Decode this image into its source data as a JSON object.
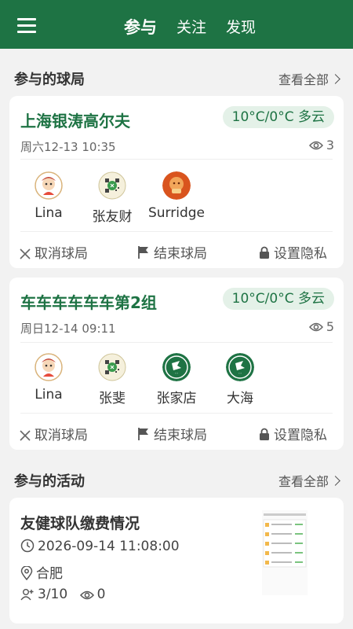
{
  "nav": {
    "tabs": [
      "参与",
      "关注",
      "发现"
    ]
  },
  "games_section": {
    "title": "参与的球局",
    "see_all": "查看全部"
  },
  "games": [
    {
      "title": "上海银涛高尔夫",
      "weather": "10°C/0°C 多云",
      "date": "周六12-13 10:35",
      "views": "3",
      "players": [
        {
          "name": "Lina",
          "avatar": "cartoon"
        },
        {
          "name": "张友财",
          "avatar": "qr"
        },
        {
          "name": "Surridge",
          "avatar": "orange"
        }
      ]
    },
    {
      "title": "车车车车车车第2组",
      "weather": "10°C/0°C 多云",
      "date": "周日12-14 09:11",
      "views": "5",
      "players": [
        {
          "name": "Lina",
          "avatar": "cartoon"
        },
        {
          "name": "张斐",
          "avatar": "qr"
        },
        {
          "name": "张家店",
          "avatar": "green"
        },
        {
          "name": "大海",
          "avatar": "green"
        }
      ]
    }
  ],
  "actions": {
    "cancel": "取消球局",
    "end": "结束球局",
    "privacy": "设置隐私"
  },
  "activities_section": {
    "title": "参与的活动",
    "see_all": "查看全部"
  },
  "activity": {
    "title": "友健球队缴费情况",
    "datetime": "2026-09-14 11:08:00",
    "location": "合肥",
    "members": "3/10",
    "views": "0"
  },
  "colors": {
    "brand": "#1e7344",
    "weather_bg": "#e4f1e8",
    "card": "#ffffff",
    "page_bg": "#f2f2f2"
  }
}
